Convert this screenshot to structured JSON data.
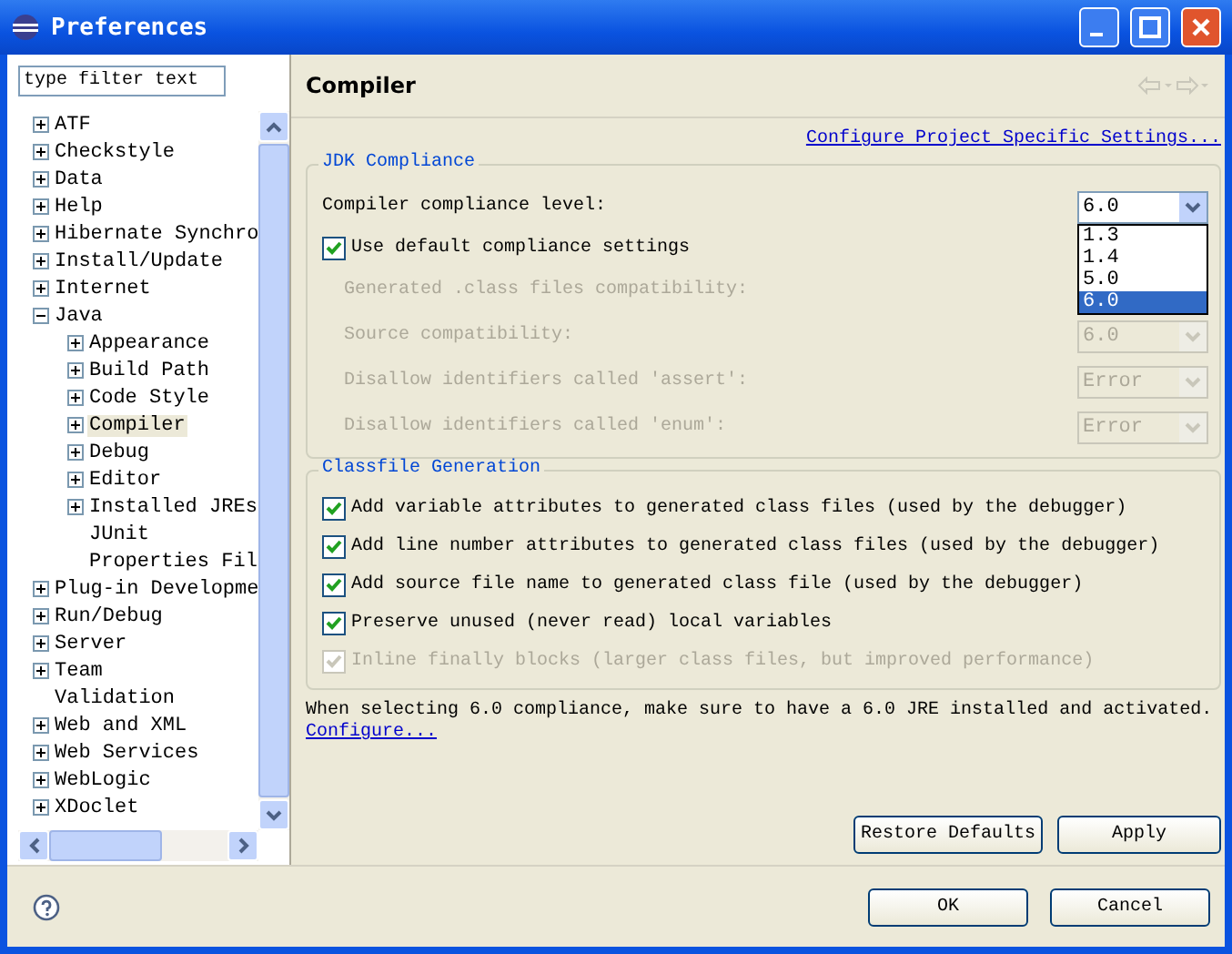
{
  "window": {
    "title": "Preferences"
  },
  "filter": {
    "placeholder": "type filter text"
  },
  "tree": [
    {
      "label": "ATF",
      "kind": "folder",
      "expanded": false,
      "selected": false
    },
    {
      "label": "Checkstyle",
      "kind": "folder",
      "expanded": false,
      "selected": false
    },
    {
      "label": "Data",
      "kind": "folder",
      "expanded": false,
      "selected": false
    },
    {
      "label": "Help",
      "kind": "folder",
      "expanded": false,
      "selected": false
    },
    {
      "label": "Hibernate Synchro",
      "kind": "folder",
      "expanded": false,
      "selected": false
    },
    {
      "label": "Install/Update",
      "kind": "folder",
      "expanded": false,
      "selected": false
    },
    {
      "label": "Internet",
      "kind": "folder",
      "expanded": false,
      "selected": false
    },
    {
      "label": "Java",
      "kind": "folder",
      "expanded": true,
      "selected": false,
      "children": [
        {
          "label": "Appearance",
          "kind": "folder",
          "expanded": false,
          "selected": false
        },
        {
          "label": "Build Path",
          "kind": "folder",
          "expanded": false,
          "selected": false
        },
        {
          "label": "Code Style",
          "kind": "folder",
          "expanded": false,
          "selected": false
        },
        {
          "label": "Compiler",
          "kind": "folder",
          "expanded": false,
          "selected": true
        },
        {
          "label": "Debug",
          "kind": "folder",
          "expanded": false,
          "selected": false
        },
        {
          "label": "Editor",
          "kind": "folder",
          "expanded": false,
          "selected": false
        },
        {
          "label": "Installed JREs",
          "kind": "folder",
          "expanded": false,
          "selected": false
        },
        {
          "label": "JUnit",
          "kind": "leaf",
          "selected": false
        },
        {
          "label": "Properties Fil",
          "kind": "leaf",
          "selected": false
        }
      ]
    },
    {
      "label": "Plug-in Developme",
      "kind": "folder",
      "expanded": false,
      "selected": false
    },
    {
      "label": "Run/Debug",
      "kind": "folder",
      "expanded": false,
      "selected": false
    },
    {
      "label": "Server",
      "kind": "folder",
      "expanded": false,
      "selected": false
    },
    {
      "label": "Team",
      "kind": "folder",
      "expanded": false,
      "selected": false
    },
    {
      "label": "Validation",
      "kind": "leaf",
      "selected": false
    },
    {
      "label": "Web and XML",
      "kind": "folder",
      "expanded": false,
      "selected": false
    },
    {
      "label": "Web Services",
      "kind": "folder",
      "expanded": false,
      "selected": false
    },
    {
      "label": "WebLogic",
      "kind": "folder",
      "expanded": false,
      "selected": false
    },
    {
      "label": "XDoclet",
      "kind": "folder",
      "expanded": false,
      "selected": false
    }
  ],
  "page": {
    "title": "Compiler",
    "project_link": "Configure Project Specific Settings..."
  },
  "jdk_group": {
    "title": "JDK Compliance",
    "compliance": {
      "label": "Compiler compliance level:",
      "value": "6.0",
      "open": true,
      "options": [
        {
          "label": "1.3",
          "selected": false
        },
        {
          "label": "1.4",
          "selected": false
        },
        {
          "label": "5.0",
          "selected": false
        },
        {
          "label": "6.0",
          "selected": true
        }
      ]
    },
    "use_default": {
      "label": "Use default compliance settings",
      "checked": true,
      "disabled": false
    },
    "settings": [
      {
        "label": "Generated .class files compatibility:",
        "disabled": true
      },
      {
        "label": "Source compatibility:",
        "value": "6.0",
        "disabled": true
      },
      {
        "label": "Disallow identifiers called 'assert':",
        "value": "Error",
        "disabled": true
      },
      {
        "label": "Disallow identifiers called 'enum':",
        "value": "Error",
        "disabled": true
      }
    ]
  },
  "classfile_group": {
    "title": "Classfile Generation",
    "options": [
      {
        "label": "Add variable attributes to generated class files (used by the debugger)",
        "checked": true,
        "disabled": false
      },
      {
        "label": "Add line number attributes to generated class files (used by the debugger)",
        "checked": true,
        "disabled": false
      },
      {
        "label": "Add source file name to generated class file (used by the debugger)",
        "checked": true,
        "disabled": false
      },
      {
        "label": "Preserve unused (never read) local variables",
        "checked": true,
        "disabled": false
      },
      {
        "label": "Inline finally blocks (larger class files, but improved performance)",
        "checked": true,
        "disabled": true
      }
    ]
  },
  "note": {
    "text": "When selecting 6.0 compliance, make sure to have a 6.0 JRE installed and activated.",
    "link": "Configure..."
  },
  "page_buttons": [
    "Restore Defaults",
    "Apply"
  ],
  "dialog_buttons": [
    "OK",
    "Cancel"
  ]
}
